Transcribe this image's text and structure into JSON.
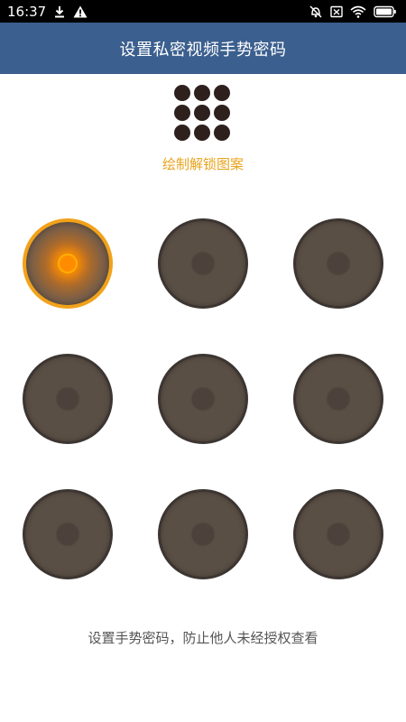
{
  "status_bar": {
    "time": "16:37",
    "left_icons": [
      "download-icon",
      "warning-icon"
    ],
    "right_icons": [
      "alarm-off-icon",
      "sim-off-icon",
      "wifi-icon",
      "battery-icon"
    ]
  },
  "header": {
    "title": "设置私密视频手势密码"
  },
  "preview": {
    "dot_count": 9
  },
  "hint_text": "绘制解锁图案",
  "pattern": {
    "nodes": [
      {
        "index": 1,
        "active": true
      },
      {
        "index": 2,
        "active": false
      },
      {
        "index": 3,
        "active": false
      },
      {
        "index": 4,
        "active": false
      },
      {
        "index": 5,
        "active": false
      },
      {
        "index": 6,
        "active": false
      },
      {
        "index": 7,
        "active": false
      },
      {
        "index": 8,
        "active": false
      },
      {
        "index": 9,
        "active": false
      }
    ]
  },
  "footer_text": "设置手势密码，防止他人未经授权查看",
  "colors": {
    "status_bar_bg": "#000000",
    "title_bar_bg": "#3b5f8e",
    "hint_color": "#e8a31c",
    "node_fill": "#5a4f45",
    "active_accent": "#f2a21a",
    "preview_dot": "#2e211d",
    "footer_text_color": "#555555"
  }
}
